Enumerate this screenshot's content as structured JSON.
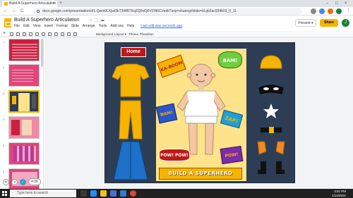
{
  "browser": {
    "tab_title": "Build A Superhero Articulation",
    "tab_close": "×",
    "new_tab": "+",
    "window_controls": [
      "–",
      "□",
      "×"
    ],
    "url": "docs.google.com/presentation/d/1-Qwm0LKjwt3kT3WBTKqZQ0sCj5VON6Cr/edit?usp=sharing#slide=id.gb3ac934b03_0_11",
    "nav": [
      "←",
      "→",
      "C"
    ]
  },
  "app": {
    "title": "Build A Superhero Articulation",
    "title_icons": [
      "☆",
      "⬚",
      "☁"
    ],
    "menus": [
      "File",
      "Edit",
      "View",
      "Insert",
      "Format",
      "Slide",
      "Arrange",
      "Tools",
      "Add-ons",
      "Help"
    ],
    "last_edit": "Last edit was seconds ago",
    "present_label": "Present",
    "share_label": "Share",
    "avatar_letter": "J"
  },
  "toolbar": {
    "plus": "+",
    "background": "Background",
    "layout": "Layout ▾",
    "theme": "Theme",
    "transition": "Transition"
  },
  "filmstrip": {
    "numbers": [
      "1",
      "2",
      "3",
      "4",
      "5",
      "6"
    ],
    "selected_index": 3
  },
  "slide": {
    "home_label": "Home",
    "banner_text": "BUILD A SUPERHERO",
    "bursts": [
      "KA-BOOM",
      "BAM!",
      "BAM!",
      "ZAP!",
      "POW! POW!",
      "POW!"
    ]
  },
  "recorder": {
    "time": "4:36"
  },
  "taskbar": {
    "search_placeholder": "Type here to search",
    "time": "3:51 PM",
    "date": "1/14/2021"
  },
  "colors": {
    "slide_bg": "#2c3d55",
    "panel": "#ffe38a",
    "accent": "#f6b400",
    "home": "#c01818"
  }
}
